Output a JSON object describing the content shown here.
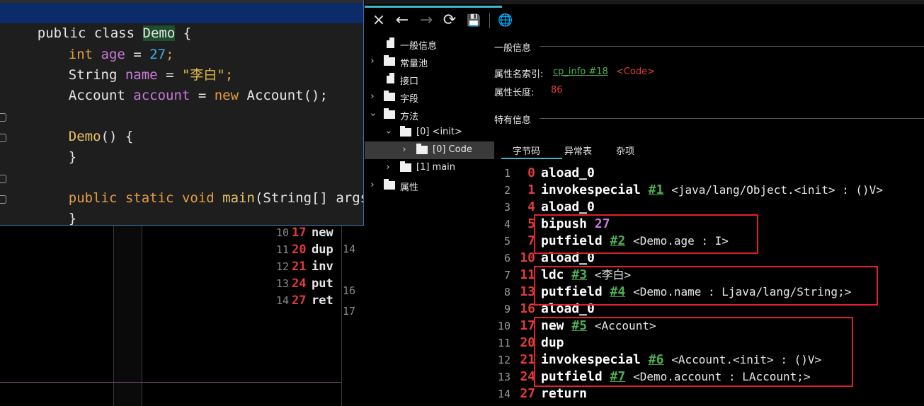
{
  "background_editor": {
    "gutter_numbers": [
      "14",
      "16",
      "17"
    ],
    "lines": [
      {
        "ln": "10",
        "offset": "17",
        "op": "new"
      },
      {
        "ln": "11",
        "offset": "20",
        "op": "dup"
      },
      {
        "ln": "12",
        "offset": "21",
        "op": "inv"
      },
      {
        "ln": "13",
        "offset": "24",
        "op": "put"
      },
      {
        "ln": "14",
        "offset": "27",
        "op": "ret"
      }
    ]
  },
  "code_popup": {
    "line1": {
      "kw1": "public",
      "kw2": "class",
      "name": "Demo",
      "brace": "{"
    },
    "line2": {
      "type": "int",
      "var": "age",
      "eq": "=",
      "num": "27",
      "semi": ";"
    },
    "line3": {
      "type": "String",
      "var": "name",
      "eq": "=",
      "str": "\"李白\"",
      "semi": ";"
    },
    "line4": {
      "type": "Account",
      "var": "account",
      "eq": "=",
      "kw": "new",
      "ctor": "Account();"
    },
    "line5": {
      "fn": "Demo",
      "rest": "() {"
    },
    "line6": {
      "text": "}"
    },
    "line7": {
      "kw1": "public",
      "kw2": "static",
      "kw3": "void",
      "fn": "main",
      "rest": "(String[] args) {"
    },
    "line8": {
      "text": "}"
    },
    "line9": {
      "text": "}"
    }
  },
  "toolbar": {
    "close_icon": "×",
    "back_icon": "←",
    "forward_icon": "→",
    "refresh_icon": "⟳",
    "save_icon": "💾",
    "globe_icon": "🌐"
  },
  "tree": {
    "items": [
      {
        "label": "一般信息",
        "icon": "file-icon",
        "expandable": false
      },
      {
        "label": "常量池",
        "icon": "folder-icon",
        "expandable": true
      },
      {
        "label": "接口",
        "icon": "file-icon",
        "expandable": false
      },
      {
        "label": "字段",
        "icon": "folder-icon",
        "expandable": true
      },
      {
        "label": "方法",
        "icon": "folder-icon",
        "expandable": true,
        "expanded": true
      },
      {
        "label": "[0] <init>",
        "icon": "folder-icon",
        "expandable": true,
        "expanded": true
      },
      {
        "label": "[0] Code",
        "icon": "folder-icon",
        "expandable": true,
        "selected": true
      },
      {
        "label": "[1] main",
        "icon": "folder-icon",
        "expandable": true
      },
      {
        "label": "属性",
        "icon": "folder-icon",
        "expandable": true
      }
    ]
  },
  "detail": {
    "general_title": "一般信息",
    "attr_name_index_label": "属性名索引:",
    "attr_name_index_link": "cp_info #18",
    "attr_name_index_value": "<Code>",
    "attr_length_label": "属性长度:",
    "attr_length_value": "86",
    "specific_title": "特有信息",
    "tabs": [
      "字节码",
      "异常表",
      "杂项"
    ]
  },
  "bytecode": [
    {
      "ln": "1",
      "offset": "0",
      "op": "aload_0",
      "ref": "",
      "arg": "",
      "comment": ""
    },
    {
      "ln": "2",
      "offset": "1",
      "op": "invokespecial",
      "ref": "#1",
      "arg": "",
      "comment": "<java/lang/Object.<init> : ()V>"
    },
    {
      "ln": "3",
      "offset": "4",
      "op": "aload_0",
      "ref": "",
      "arg": "",
      "comment": ""
    },
    {
      "ln": "4",
      "offset": "5",
      "op": "bipush",
      "ref": "",
      "arg": "27",
      "comment": ""
    },
    {
      "ln": "5",
      "offset": "7",
      "op": "putfield",
      "ref": "#2",
      "arg": "",
      "comment": "<Demo.age : I>"
    },
    {
      "ln": "6",
      "offset": "10",
      "op": "aload_0",
      "ref": "",
      "arg": "",
      "comment": ""
    },
    {
      "ln": "7",
      "offset": "11",
      "op": "ldc",
      "ref": "#3",
      "arg": "",
      "comment": "<李白>"
    },
    {
      "ln": "8",
      "offset": "13",
      "op": "putfield",
      "ref": "#4",
      "arg": "",
      "comment": "<Demo.name : Ljava/lang/String;>"
    },
    {
      "ln": "9",
      "offset": "16",
      "op": "aload_0",
      "ref": "",
      "arg": "",
      "comment": ""
    },
    {
      "ln": "10",
      "offset": "17",
      "op": "new",
      "ref": "#5",
      "arg": "",
      "comment": "<Account>"
    },
    {
      "ln": "11",
      "offset": "20",
      "op": "dup",
      "ref": "",
      "arg": "",
      "comment": ""
    },
    {
      "ln": "12",
      "offset": "21",
      "op": "invokespecial",
      "ref": "#6",
      "arg": "",
      "comment": "<Account.<init> : ()V>"
    },
    {
      "ln": "13",
      "offset": "24",
      "op": "putfield",
      "ref": "#7",
      "arg": "",
      "comment": "<Demo.account : LAccount;>"
    },
    {
      "ln": "14",
      "offset": "27",
      "op": "return",
      "ref": "",
      "arg": "",
      "comment": ""
    }
  ],
  "colors": {
    "accent": "#3fb7c9",
    "offset_red": "#e23b3b",
    "link_green": "#4caf50",
    "highlight_box": "#e0202a"
  }
}
